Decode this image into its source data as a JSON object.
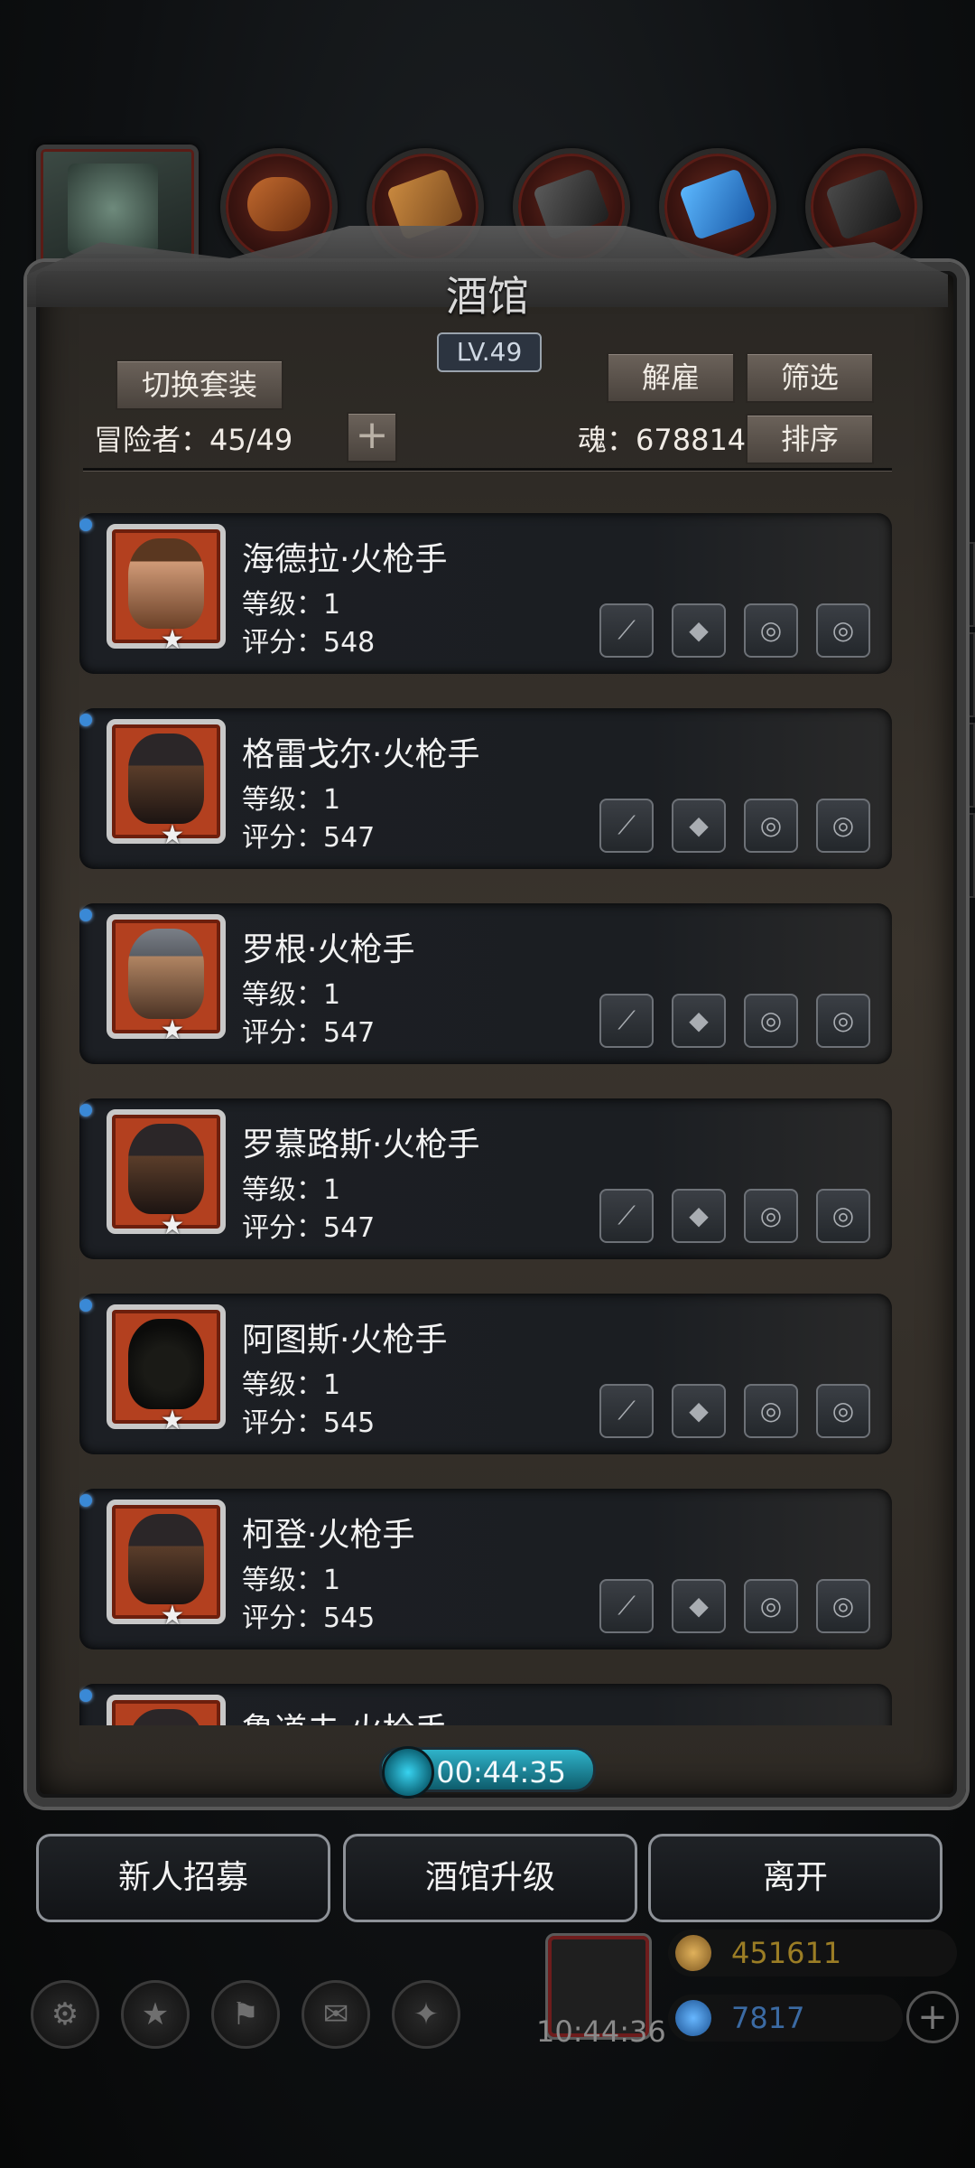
{
  "top_tabs": [
    {
      "icon": "hero-portrait-icon"
    },
    {
      "icon": "gloves-icon"
    },
    {
      "icon": "wood-plank-icon"
    },
    {
      "icon": "iron-ingot-icon"
    },
    {
      "icon": "crystal-icon"
    },
    {
      "icon": "ore-icon"
    }
  ],
  "panel": {
    "title": "酒馆",
    "level": "LV.49",
    "switch_outfit_label": "切换套装",
    "dismiss_label": "解雇",
    "filter_label": "筛选",
    "sort_label": "排序",
    "adventurers_label": "冒险者：45/49",
    "soul_label": "魂：678814"
  },
  "heroes": [
    {
      "name": "海德拉·火枪手",
      "level": "等级：1",
      "score": "评分：548",
      "portrait": "girl"
    },
    {
      "name": "格雷戈尔·火枪手",
      "level": "等级：1",
      "score": "评分：547",
      "portrait": "hat"
    },
    {
      "name": "罗根·火枪手",
      "level": "等级：1",
      "score": "评分：547",
      "portrait": "cap"
    },
    {
      "name": "罗慕路斯·火枪手",
      "level": "等级：1",
      "score": "评分：547",
      "portrait": "hat"
    },
    {
      "name": "阿图斯·火枪手",
      "level": "等级：1",
      "score": "评分：545",
      "portrait": "hood"
    },
    {
      "name": "柯登·火枪手",
      "level": "等级：1",
      "score": "评分：545",
      "portrait": "hat"
    },
    {
      "name": "鲁道夫·火枪手",
      "level": "",
      "score": "",
      "portrait": "hat"
    }
  ],
  "equipment_slots": [
    "weapon-slot-icon",
    "armor-slot-icon",
    "ring-slot-icon",
    "ring-slot-icon"
  ],
  "timer": "00:44:35",
  "bottom_buttons": {
    "recruit": "新人招募",
    "upgrade": "酒馆升级",
    "leave": "离开"
  },
  "dock": {
    "gift_time": "10:44:36",
    "gold": "451611",
    "gems": "7817"
  }
}
